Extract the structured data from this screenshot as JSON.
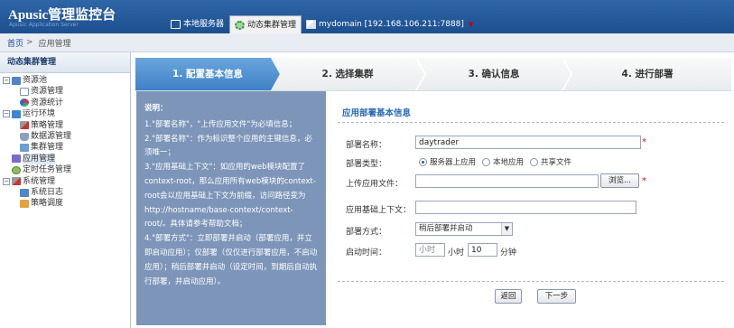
{
  "app": {
    "title": "Apusic管理监控台",
    "subtitle": "Apusic Application Server"
  },
  "top_tabs": [
    {
      "label": "本地服务器",
      "icon": "monitor-icon"
    },
    {
      "label": "动态集群管理",
      "icon": "gear-icon"
    },
    {
      "label": "mydomain [192.168.106.211:7888]",
      "icon": "domain-icon"
    }
  ],
  "breadcrumb": {
    "home": "首页",
    "separator": ">",
    "current": "应用管理"
  },
  "sidebar": {
    "title": "动态集群管理",
    "tree": [
      {
        "label": "资源池",
        "level": 0,
        "toggle": "−"
      },
      {
        "label": "资源管理",
        "level": 1
      },
      {
        "label": "资源统计",
        "level": 1
      },
      {
        "label": "运行环境",
        "level": 0,
        "toggle": "−"
      },
      {
        "label": "策略管理",
        "level": 1
      },
      {
        "label": "数据源管理",
        "level": 1
      },
      {
        "label": "集群管理",
        "level": 1
      },
      {
        "label": "应用管理",
        "level": 0,
        "toggle": "",
        "selected": true
      },
      {
        "label": "定时任务管理",
        "level": 0,
        "toggle": ""
      },
      {
        "label": "系统管理",
        "level": 0,
        "toggle": "−"
      },
      {
        "label": "系统日志",
        "level": 1
      },
      {
        "label": "策略调度",
        "level": 1
      }
    ]
  },
  "steps": [
    {
      "label": "1. 配置基本信息",
      "active": true
    },
    {
      "label": "2. 选择集群",
      "active": false
    },
    {
      "label": "3. 确认信息",
      "active": false
    },
    {
      "label": "4. 进行部署",
      "active": false
    }
  ],
  "help": {
    "title": "说明：",
    "lines": [
      "1.\"部署名称\"，\"上传应用文件\"为必填信息；",
      "2.\"部署名称\"：作为标识整个应用的主键信息，必须唯一；",
      "3.\"应用基础上下文\"：如应用的web模块配置了context-root，那么应用所有web模块的context-root会以应用基础上下文为前缀，访问路径变为http://hostname/base-context/context-root/。具体请参考帮助文档；",
      "4.\"部署方式\"：立即部署并启动（部署应用，并立即启动应用）；仅部署（仅仅进行部署应用，不启动应用）；稍后部署并启动（设定时间，到期后自动执行部署，并启动应用）。"
    ]
  },
  "form": {
    "title": "应用部署基本信息",
    "deploy_name": {
      "label": "部署名称：",
      "value": "daytrader"
    },
    "deploy_type": {
      "label": "部署类型：",
      "options": [
        "服务器上应用",
        "本地应用",
        "共享文件"
      ],
      "selected": "服务器上应用"
    },
    "upload_file": {
      "label": "上传应用文件：",
      "value": "",
      "browse_label": "浏览..."
    },
    "base_context": {
      "label": "应用基础上下文：",
      "value": ""
    },
    "deploy_mode": {
      "label": "部署方式：",
      "value": "稍后部署并启动"
    },
    "start_time": {
      "label": "启动时间：",
      "hour_placeholder": "小时",
      "hour_unit": "小时",
      "minute_value": "10",
      "minute_unit": "分钟"
    },
    "required_mark": "*",
    "back_label": "返回",
    "next_label": "下一步"
  },
  "colors": {
    "topbar": "#1c4f8f",
    "active_step": "#3e82c7",
    "help_panel": "#7d95b9",
    "form_title": "#2a6ab2",
    "required": "#d11111"
  }
}
